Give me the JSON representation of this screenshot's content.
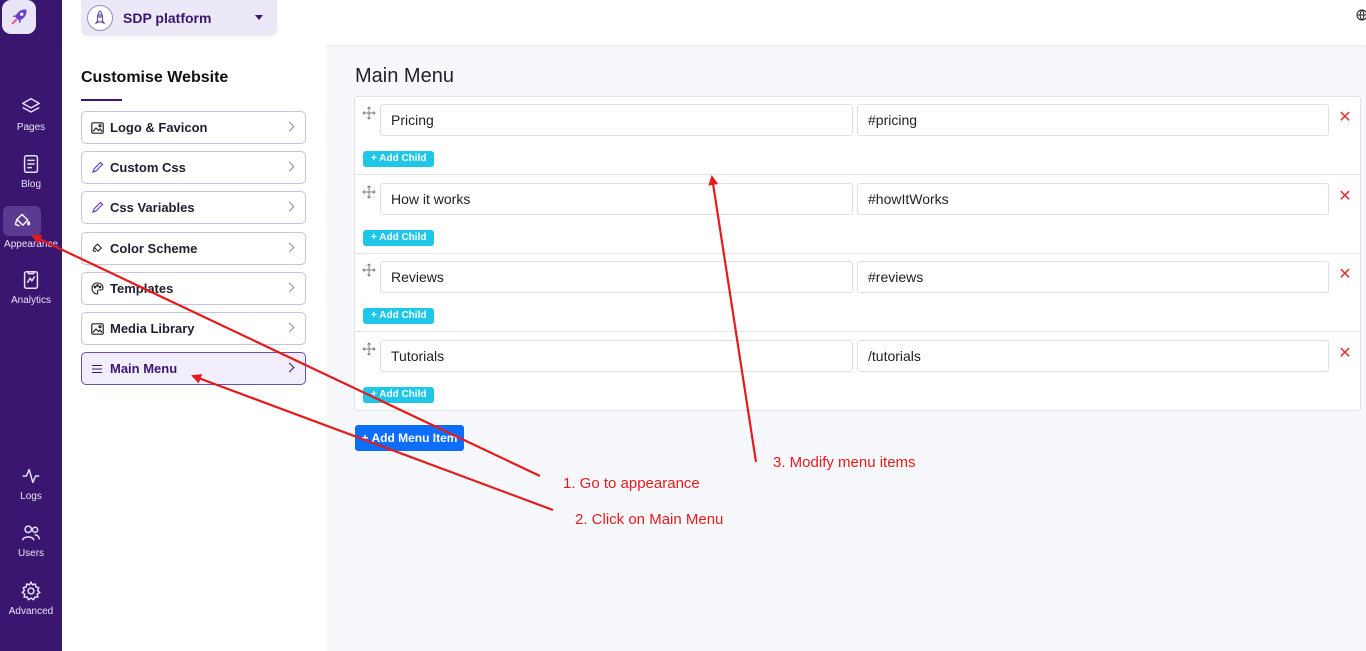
{
  "rail": {
    "items": [
      {
        "label": "Pages",
        "icon": "layers-icon"
      },
      {
        "label": "Blog",
        "icon": "notebook-icon"
      },
      {
        "label": "Appearance",
        "icon": "paint-bucket-icon",
        "active": true
      },
      {
        "label": "Analytics",
        "icon": "chart-file-icon"
      },
      {
        "label": "Logs",
        "icon": "pulse-icon"
      },
      {
        "label": "Users",
        "icon": "users-icon"
      },
      {
        "label": "Advanced",
        "icon": "gear-icon"
      }
    ]
  },
  "header": {
    "project_name": "SDP platform"
  },
  "customise": {
    "title": "Customise Website",
    "items": [
      {
        "label": "Logo & Favicon",
        "icon": "image-icon"
      },
      {
        "label": "Custom Css",
        "icon": "pencil-icon"
      },
      {
        "label": "Css Variables",
        "icon": "pencil-icon"
      },
      {
        "label": "Color Scheme",
        "icon": "paint-bucket-icon"
      },
      {
        "label": "Templates",
        "icon": "palette-icon"
      },
      {
        "label": "Media Library",
        "icon": "images-icon"
      },
      {
        "label": "Main Menu",
        "icon": "menu-lines-icon",
        "active": true
      }
    ]
  },
  "main": {
    "title": "Main Menu",
    "menu_items": [
      {
        "name": "Pricing",
        "link": "#pricing",
        "add_child": "+ Add Child",
        "remove": "✕"
      },
      {
        "name": "How it works",
        "link": "#howItWorks",
        "add_child": "+ Add Child",
        "remove": "✕"
      },
      {
        "name": "Reviews",
        "link": "#reviews",
        "add_child": "+ Add Child",
        "remove": "✕"
      },
      {
        "name": "Tutorials",
        "link": "/tutorials",
        "add_child": "+ Add Child",
        "remove": "✕"
      }
    ],
    "add_menu_item": "+ Add Menu Item"
  },
  "annotations": {
    "step1": "1. Go to appearance",
    "step2": "2. Click on Main Menu",
    "step3": "3. Modify menu items",
    "color": "#e51b1b"
  },
  "colors": {
    "rail_bg": "#3a1670",
    "accent": "#3a1670",
    "add_child_bg": "#1ec6e8",
    "primary_button": "#0d6efd",
    "remove": "#e03535"
  }
}
